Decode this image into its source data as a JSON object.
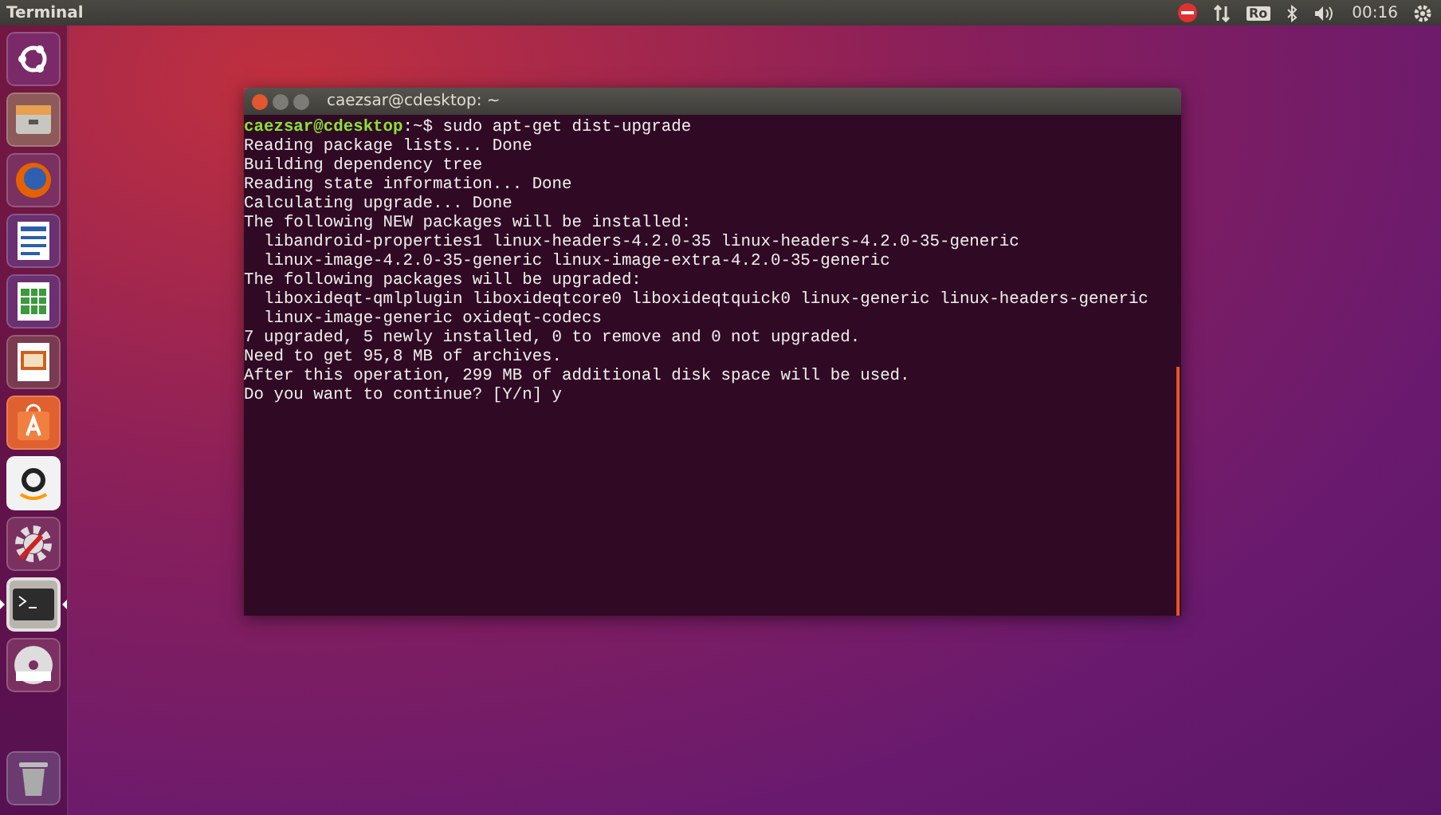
{
  "top_bar": {
    "app_title": "Terminal",
    "keyboard_layout": "Ro",
    "clock": "00:16"
  },
  "launcher": [
    {
      "kind": "dash",
      "active": false
    },
    {
      "kind": "files",
      "active": false
    },
    {
      "kind": "browser",
      "active": false
    },
    {
      "kind": "writer",
      "active": false
    },
    {
      "kind": "calc",
      "active": false
    },
    {
      "kind": "impress",
      "active": false
    },
    {
      "kind": "store",
      "active": false
    },
    {
      "kind": "amazon",
      "active": false
    },
    {
      "kind": "settings",
      "active": false
    },
    {
      "kind": "terminal",
      "active": true
    },
    {
      "kind": "dvd",
      "active": false
    },
    {
      "kind": "trash",
      "active": false
    }
  ],
  "terminal": {
    "title": "caezsar@cdesktop: ~",
    "prompt": {
      "user_host": "caezsar@cdesktop",
      "path": ":~$",
      "command": "sudo apt-get dist-upgrade"
    },
    "output": [
      "Reading package lists... Done",
      "Building dependency tree",
      "Reading state information... Done",
      "Calculating upgrade... Done",
      "The following NEW packages will be installed:",
      "  libandroid-properties1 linux-headers-4.2.0-35 linux-headers-4.2.0-35-generic",
      "  linux-image-4.2.0-35-generic linux-image-extra-4.2.0-35-generic",
      "The following packages will be upgraded:",
      "  liboxideqt-qmlplugin liboxideqtcore0 liboxideqtquick0 linux-generic linux-headers-generic",
      "  linux-image-generic oxideqt-codecs",
      "7 upgraded, 5 newly installed, 0 to remove and 0 not upgraded.",
      "Need to get 95,8 MB of archives.",
      "After this operation, 299 MB of additional disk space will be used.",
      "Do you want to continue? [Y/n] y"
    ]
  }
}
